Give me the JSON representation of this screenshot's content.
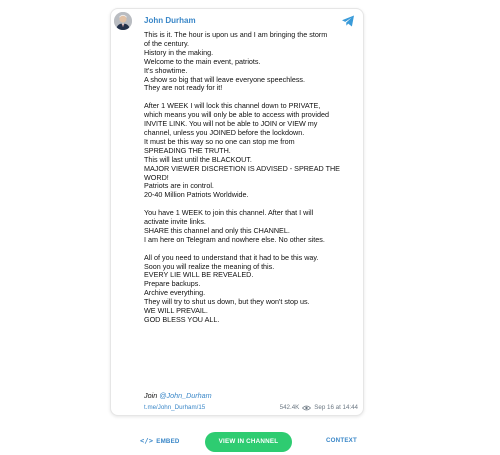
{
  "channel": {
    "name": "John Durham",
    "avatar_icon": "portrait-avatar",
    "platform_icon": "telegram-paper-plane-icon"
  },
  "post": {
    "text": "This is it. The hour is upon us and I am bringing the storm\nof the century.\nHistory in the making.\nWelcome to the main event, patriots.\nIt's showtime.\nA show so big that will leave everyone speechless.\nThey are not ready for it!\n\nAfter 1 WEEK I will lock this channel down to PRIVATE,\nwhich means you will only be able to access with provided\nINVITE LINK. You will not be able to JOIN or VIEW my\nchannel, unless you JOINED before the lockdown.\nIt must be this way so no one can stop me from\nSPREADING THE TRUTH.\nThis will last until the BLACKOUT.\nMAJOR VIEWER DISCRETION IS ADVISED - SPREAD THE\nWORD!\nPatriots are in control.\n20-40 Million Patriots Worldwide.\n\nYou have 1 WEEK to join this channel. After that I will\nactivate invite links.\nSHARE this channel and only this CHANNEL.\nI am here on Telegram and nowhere else. No other sites.\n\nAll of you need to understand that it had to be this way.\nSoon you will realize the meaning of this.\nEVERY LIE WILL BE REVEALED.\nPrepare backups.\nArchive everything.\nThey will try to shut us down, but they won't stop us.\nWE WILL PREVAIL.\nGOD BLESS YOU ALL.",
    "join_prefix": "Join ",
    "join_handle": "@John_Durham",
    "link": "t.me/John_Durham/15",
    "views": "542.4K",
    "date": "Sep 16 at 14:44"
  },
  "actions": {
    "embed_icon": "</>",
    "embed_label": "EMBED",
    "view_label": "VIEW IN CHANNEL",
    "context_label": "CONTEXT"
  },
  "colors": {
    "accent": "#3a87c8",
    "view_button": "#2ecc71",
    "meta_gray": "#6c7883"
  }
}
